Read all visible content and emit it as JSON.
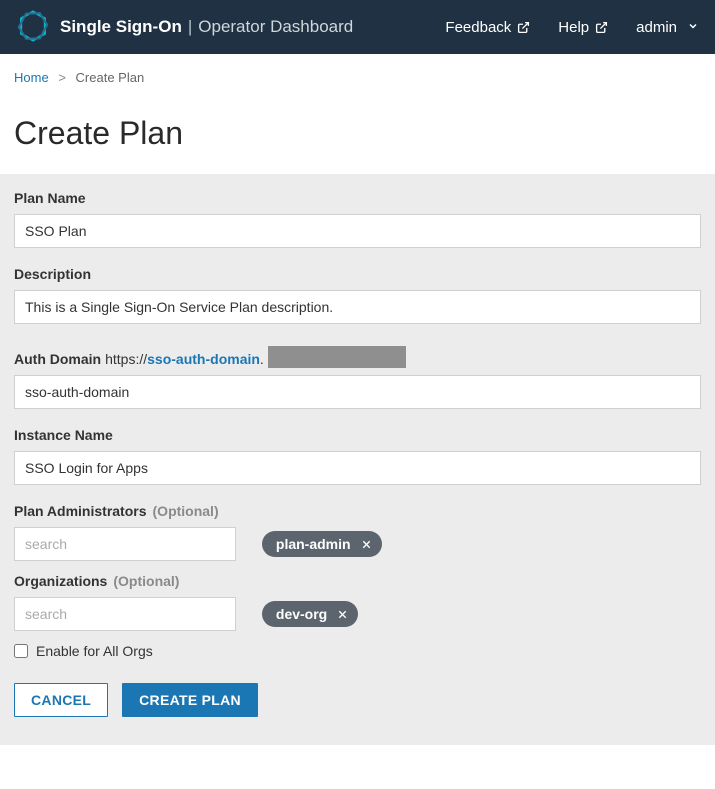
{
  "header": {
    "brand_main": "Single Sign-On",
    "brand_sub": "Operator Dashboard",
    "links": {
      "feedback": "Feedback",
      "help": "Help"
    },
    "user": "admin"
  },
  "breadcrumb": {
    "home": "Home",
    "current": "Create Plan"
  },
  "page_title": "Create Plan",
  "form": {
    "plan_name": {
      "label": "Plan Name",
      "value": "SSO Plan"
    },
    "description": {
      "label": "Description",
      "value": "This is a Single Sign-On Service Plan description."
    },
    "auth_domain": {
      "label": "Auth Domain",
      "url_prefix": "https://",
      "url_subdomain": "sso-auth-domain",
      "url_dot": ".",
      "value": "sso-auth-domain"
    },
    "instance_name": {
      "label": "Instance Name",
      "value": "SSO Login for Apps"
    },
    "plan_admins": {
      "label": "Plan Administrators",
      "optional": "(Optional)",
      "placeholder": "search",
      "chip": "plan-admin"
    },
    "organizations": {
      "label": "Organizations",
      "optional": "(Optional)",
      "placeholder": "search",
      "chip": "dev-org"
    },
    "enable_all_orgs": {
      "label": "Enable for All Orgs",
      "checked": false
    },
    "buttons": {
      "cancel": "Cancel",
      "submit": "Create Plan"
    }
  }
}
